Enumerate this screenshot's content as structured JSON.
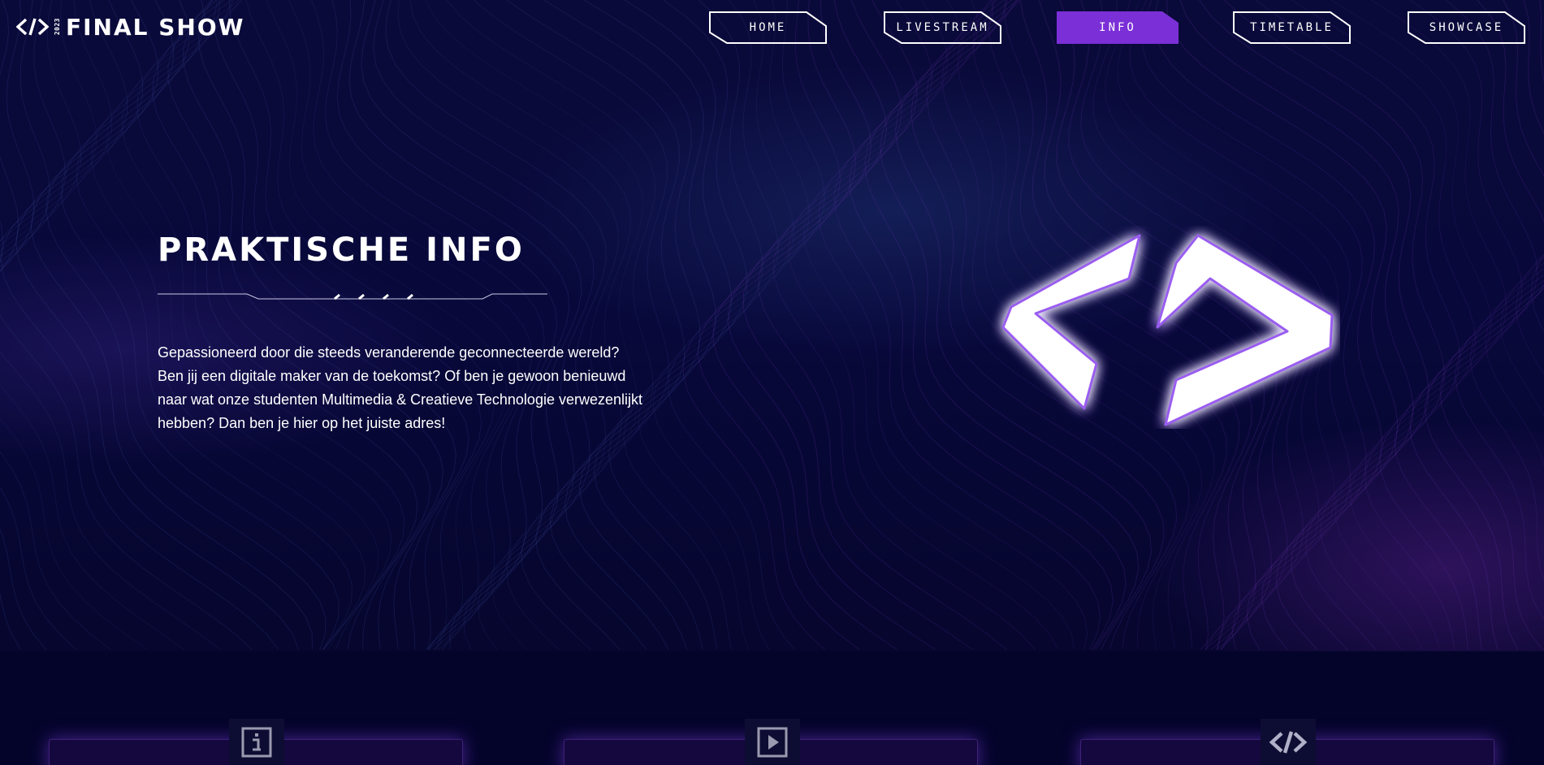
{
  "header": {
    "logo_year": "2023",
    "logo_text": "FINAL SHOW",
    "logo_icon": "code-brackets-icon"
  },
  "nav": {
    "items": [
      {
        "label": "HOME",
        "active": false
      },
      {
        "label": "LIVESTREAM",
        "active": false
      },
      {
        "label": "INFO",
        "active": true
      },
      {
        "label": "TIMETABLE",
        "active": false
      },
      {
        "label": "SHOWCASE",
        "active": false
      }
    ]
  },
  "main": {
    "title": "PRAKTISCHE INFO",
    "intro_lines": [
      "Gepassioneerd door die steeds veranderende geconnecteerde wereld?",
      "Ben jij een digitale maker van de toekomst? Of ben je gewoon benieuwd",
      "naar wat onze studenten Multimedia & Creatieve Technologie verwezenlijkt",
      "hebben? Dan ben je hier op het juiste adres!"
    ],
    "hero_icon": "code-brackets-icon"
  },
  "cards": [
    {
      "icon": "info-icon"
    },
    {
      "icon": "play-icon"
    },
    {
      "icon": "code-brackets-icon"
    }
  ],
  "colors": {
    "background": "#05052a",
    "accent": "#7b2fd6",
    "text": "#ffffff"
  }
}
